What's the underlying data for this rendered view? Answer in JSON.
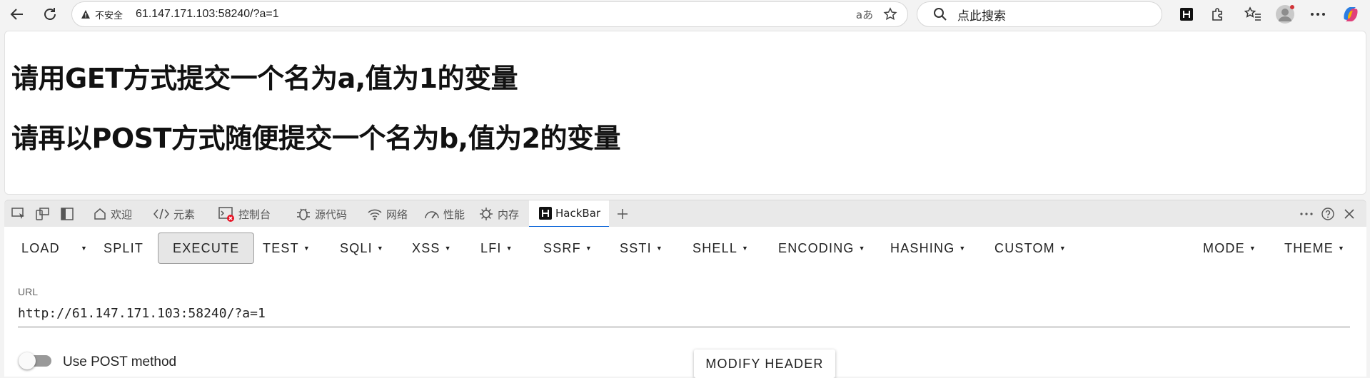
{
  "browser": {
    "security_label": "不安全",
    "url": "61.147.171.103:58240/?a=1",
    "search_placeholder": "点此搜索"
  },
  "page": {
    "line1": "请用GET方式提交一个名为a,值为1的变量",
    "line2": "请再以POST方式随便提交一个名为b,值为2的变量"
  },
  "devtools": {
    "tabs": [
      {
        "label": "欢迎",
        "icon": "home-icon"
      },
      {
        "label": "元素",
        "icon": "code-icon"
      },
      {
        "label": "控制台",
        "icon": "console-icon"
      },
      {
        "label": "源代码",
        "icon": "bug-icon"
      },
      {
        "label": "网络",
        "icon": "wifi-icon"
      },
      {
        "label": "性能",
        "icon": "gauge-icon"
      },
      {
        "label": "内存",
        "icon": "chip-icon"
      },
      {
        "label": "HackBar",
        "icon": "hackbar-icon"
      }
    ],
    "active_tab": "HackBar"
  },
  "hackbar": {
    "menu": {
      "load": "LOAD",
      "split": "SPLIT",
      "execute": "EXECUTE",
      "test": "TEST",
      "sqli": "SQLI",
      "xss": "XSS",
      "lfi": "LFI",
      "ssrf": "SSRF",
      "ssti": "SSTI",
      "shell": "SHELL",
      "encoding": "ENCODING",
      "hashing": "HASHING",
      "custom": "CUSTOM",
      "mode": "MODE",
      "theme": "THEME"
    },
    "url_label": "URL",
    "url_value": "http://61.147.171.103:58240/?a=1",
    "post_toggle_label": "Use POST method",
    "post_enabled": false,
    "modify_header": "MODIFY HEADER"
  },
  "colors": {
    "accent": "#0a64d8",
    "toolbar_bg": "#f3f3f3"
  }
}
